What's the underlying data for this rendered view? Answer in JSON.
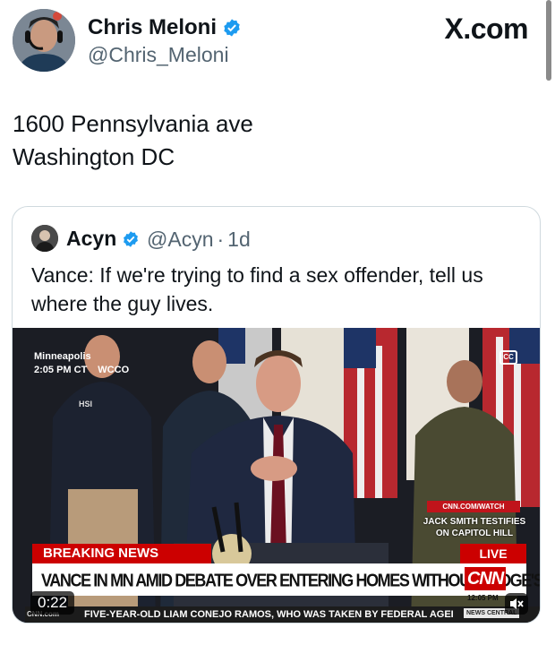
{
  "header": {
    "author_name": "Chris Meloni",
    "author_handle": "@Chris_Meloni",
    "site_logo": "X.com",
    "verified_icon": "verified-badge-icon"
  },
  "tweet": {
    "line1": "1600 Pennsylvania ave",
    "line2": "Washington DC"
  },
  "quote": {
    "author_name": "Acyn",
    "author_handle": "@Acyn",
    "separator": "·",
    "age": "1d",
    "text": "Vance: If we're trying to find a sex offender, tell us where the guy lives."
  },
  "video": {
    "location": "Minneapolis",
    "time": "2:05 PM CT",
    "station": "WCCO",
    "cc_label": "CC",
    "cnn_watch": "CNN.COM/WATCH",
    "side_headline": "JACK SMITH TESTIFIES ON CAPITOL HILL",
    "breaking_label": "BREAKING NEWS",
    "live_label": "LIVE",
    "headline": "VANCE IN MN AMID DEBATE OVER ENTERING HOMES WITHOUT JUDGE'S WARRANT",
    "network_logo": "CNN",
    "clock": "12:05 PM",
    "ticker_logo": "CNN.com",
    "ticker_text": "FIVE-YEAR-OLD LIAM CONEJO RAMOS, WHO WAS TAKEN BY FEDERAL AGEI",
    "ticker_tag": "NEWS CENTRAL",
    "duration": "0:22",
    "mute_icon": "speaker-muted-icon",
    "jacket_label": "HSI"
  },
  "colors": {
    "verified": "#1d9bf0",
    "cnn_red": "#cc0000",
    "text": "#0f1419",
    "secondary": "#536471"
  }
}
